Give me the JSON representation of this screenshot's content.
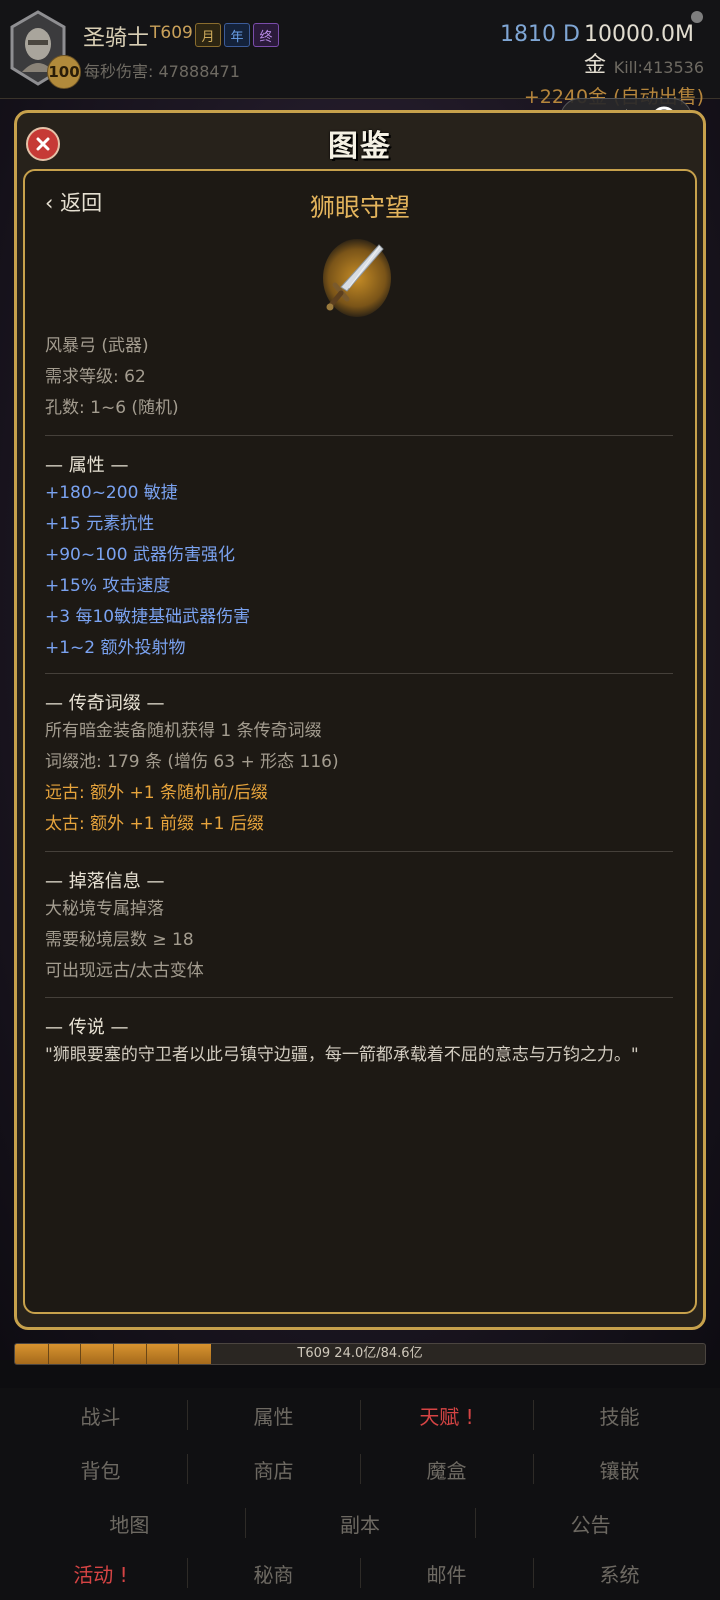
{
  "header": {
    "player_name": "圣骑士",
    "tier": "T609",
    "tags": [
      "月",
      "年",
      "终"
    ],
    "level": "100",
    "dps_text": "每秒伤害: 47888471",
    "diamonds": "1810 D",
    "gold": "10000.0M 金",
    "kills": "Kill:413536",
    "earnings": "+2240金 (自动出售)"
  },
  "modal": {
    "title": "图鉴",
    "back_label": "‹ 返回",
    "item_name": "狮眼守望",
    "basic_info": [
      "风暴弓 (武器)",
      "需求等级: 62",
      "孔数: 1~6 (随机)"
    ],
    "attributes": {
      "heading": "— 属性 —",
      "lines": [
        "+180~200 敏捷",
        "+15 元素抗性",
        "+90~100 武器伤害强化",
        "+15% 攻击速度",
        "+3 每10敏捷基础武器伤害",
        "+1~2 额外投射物"
      ]
    },
    "legendary_affix": {
      "heading": "— 传奇词缀 —",
      "lines": [
        "所有暗金装备随机获得 1 条传奇词缀",
        "词缀池: 179 条 (增伤 63 + 形态 116)"
      ],
      "highlight_lines": [
        "远古: 额外 +1 条随机前/后缀",
        "太古: 额外 +1 前缀 +1 后缀"
      ]
    },
    "drop_info": {
      "heading": "— 掉落信息 —",
      "lines": [
        "大秘境专属掉落",
        "需要秘境层数 ≥ 18",
        "可出现远古/太古变体"
      ]
    },
    "lore": {
      "heading": "— 传说 —",
      "text": "\"狮眼要塞的守卫者以此弓镇守边疆，每一箭都承载着不屈的意志与万钧之力。\""
    }
  },
  "progress": {
    "label": "T609  24.0亿/84.6亿",
    "fraction": 0.284,
    "segments": 6
  },
  "nav": {
    "row1": [
      "战斗",
      "属性",
      "天赋 !",
      "技能"
    ],
    "row2": [
      "背包",
      "商店",
      "魔盒",
      "镶嵌"
    ],
    "row3": [
      "地图",
      "副本",
      "公告"
    ],
    "row4": [
      "活动 !",
      "秘商",
      "邮件",
      "系统"
    ],
    "alert_color": "#d64444"
  },
  "colors": {
    "accent_gold": "#c7a14c",
    "stat_blue": "#7aa2f0",
    "affix_orange": "#e7a43c"
  }
}
